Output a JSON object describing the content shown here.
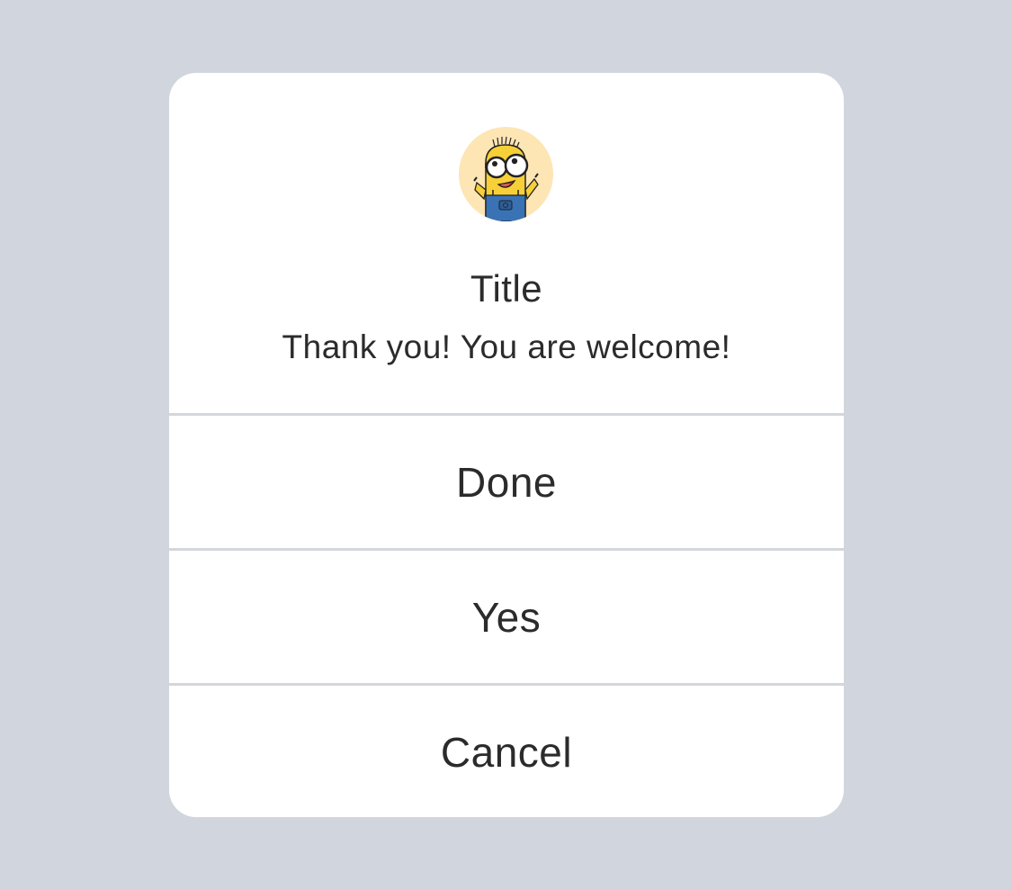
{
  "dialog": {
    "title": "Title",
    "message": "Thank you! You are welcome!",
    "avatar_icon": "minion-avatar-icon",
    "actions": [
      {
        "label": "Done"
      },
      {
        "label": "Yes"
      },
      {
        "label": "Cancel"
      }
    ]
  },
  "colors": {
    "backdrop": "#d1d5dd",
    "dialog_background": "#ffffff",
    "text": "#2b2b2b",
    "divider": "#d3d6db",
    "avatar_background": "#fde5b4"
  }
}
